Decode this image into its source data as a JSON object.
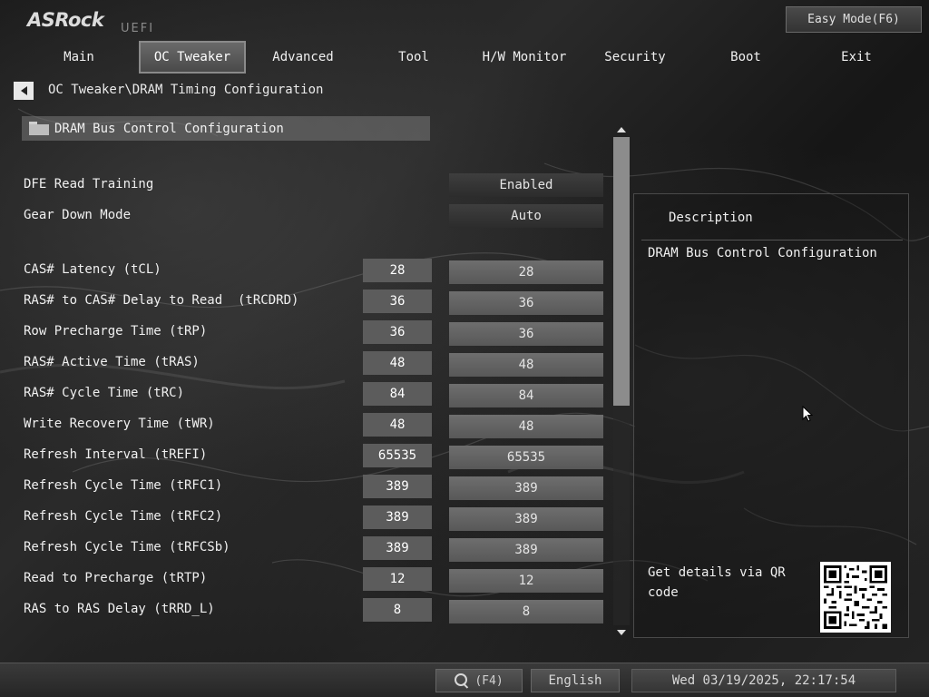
{
  "header": {
    "logo": "ASRock",
    "logo_sub": "UEFI",
    "easy_mode_label": "Easy Mode(F6)"
  },
  "tabs": [
    {
      "label": "Main",
      "active": false
    },
    {
      "label": "OC Tweaker",
      "active": true
    },
    {
      "label": "Advanced",
      "active": false
    },
    {
      "label": "Tool",
      "active": false
    },
    {
      "label": "H/W Monitor",
      "active": false
    },
    {
      "label": "Security",
      "active": false
    },
    {
      "label": "Boot",
      "active": false
    },
    {
      "label": "Exit",
      "active": false
    }
  ],
  "breadcrumb": "OC Tweaker\\DRAM Timing Configuration",
  "section": {
    "label": "DRAM Bus Control Configuration"
  },
  "options": [
    {
      "label": "DFE Read Training",
      "value": "Enabled"
    },
    {
      "label": "Gear Down Mode",
      "value": "Auto"
    }
  ],
  "timings": [
    {
      "label": "CAS# Latency (tCL)",
      "current": "28",
      "value": "28"
    },
    {
      "label": "RAS# to CAS# Delay to Read  (tRCDRD)",
      "current": "36",
      "value": "36"
    },
    {
      "label": "Row Precharge Time (tRP)",
      "current": "36",
      "value": "36"
    },
    {
      "label": "RAS# Active Time (tRAS)",
      "current": "48",
      "value": "48"
    },
    {
      "label": "RAS# Cycle Time (tRC)",
      "current": "84",
      "value": "84"
    },
    {
      "label": "Write Recovery Time (tWR)",
      "current": "48",
      "value": "48"
    },
    {
      "label": "Refresh Interval (tREFI)",
      "current": "65535",
      "value": "65535"
    },
    {
      "label": "Refresh Cycle Time (tRFC1)",
      "current": "389",
      "value": "389"
    },
    {
      "label": "Refresh Cycle Time (tRFC2)",
      "current": "389",
      "value": "389"
    },
    {
      "label": "Refresh Cycle Time (tRFCSb)",
      "current": "389",
      "value": "389"
    },
    {
      "label": "Read to Precharge (tRTP)",
      "current": "12",
      "value": "12"
    },
    {
      "label": "RAS to RAS Delay (tRRD_L)",
      "current": "8",
      "value": "8"
    }
  ],
  "scroll": {
    "thumb_fraction": 0.55
  },
  "description": {
    "title": "Description",
    "text": "DRAM Bus Control Configuration",
    "qr_text": "Get details via QR code"
  },
  "footer": {
    "search_label": "(F4)",
    "language": "English",
    "datetime": "Wed 03/19/2025, 22:17:54"
  },
  "icons": {
    "back": "back-arrow-icon",
    "folder": "folder-icon",
    "search": "search-icon",
    "scroll_up": "scroll-up-arrow-icon",
    "scroll_down": "scroll-down-arrow-icon",
    "qr": "qr-code-icon",
    "cursor": "mouse-cursor-icon"
  },
  "colors": {
    "active_tab": "#5a5a5a",
    "value_box": "#5c5c5c",
    "option_box": "#636363",
    "panel_border": "#4a4a4a"
  }
}
